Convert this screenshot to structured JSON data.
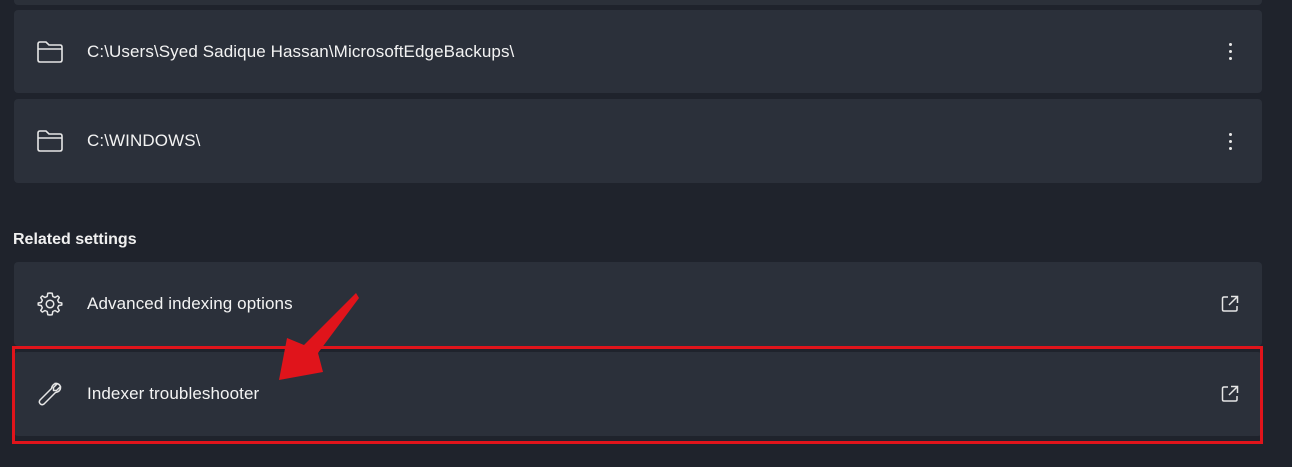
{
  "folders": [
    {
      "path": "C:\\Users\\Syed Sadique Hassan\\MicrosoftEdgeBackups\\",
      "icon": "folder-icon",
      "menu_icon": "more-options-icon"
    },
    {
      "path": "C:\\WINDOWS\\",
      "icon": "folder-icon",
      "menu_icon": "more-options-icon"
    }
  ],
  "related_settings": {
    "title": "Related settings",
    "items": [
      {
        "label": "Advanced indexing options",
        "icon": "gear-icon",
        "action_icon": "open-external-icon"
      },
      {
        "label": "Indexer troubleshooter",
        "icon": "wrench-icon",
        "action_icon": "open-external-icon"
      }
    ]
  },
  "annotation": {
    "highlight_color": "#e0141b",
    "arrow_color": "#e0141b"
  },
  "colors": {
    "background": "#1f232c",
    "card": "#2b303a"
  }
}
